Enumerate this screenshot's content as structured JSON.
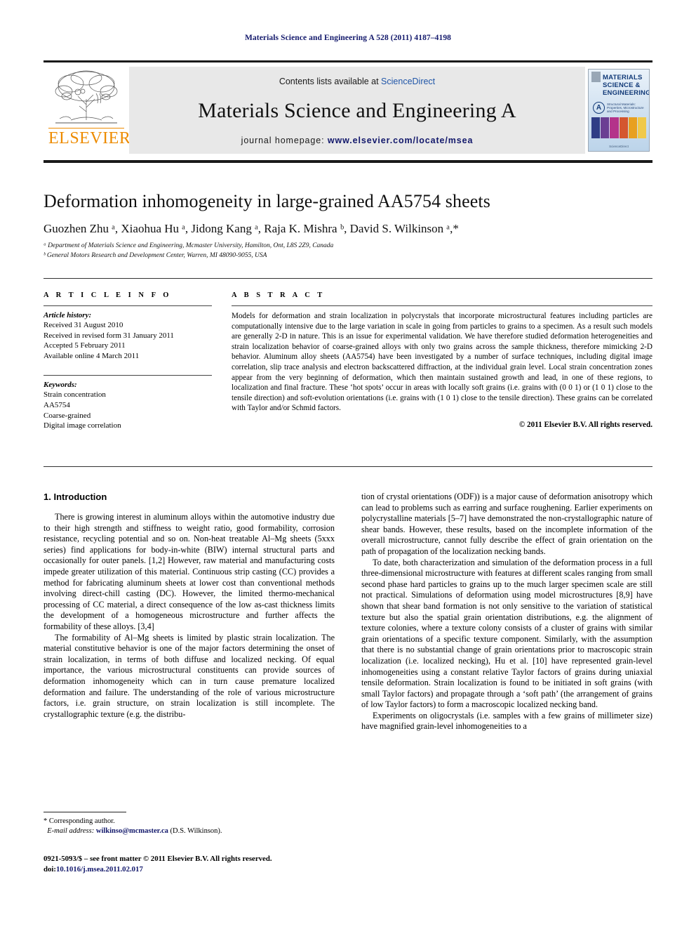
{
  "running_head": "Materials Science and Engineering A 528 (2011) 4187–4198",
  "masthead": {
    "publisher_name": "ELSEVIER",
    "contents_prefix": "Contents lists available at ",
    "contents_link": "ScienceDirect",
    "journal_title": "Materials Science and Engineering A",
    "homepage_prefix": "journal homepage:",
    "homepage_url": "www.elsevier.com/locate/msea",
    "cover": {
      "line1": "MATERIALS",
      "line2": "SCIENCE &",
      "line3": "ENGINEERING",
      "badge": "A",
      "badge_subtitle": "Structural Materials: Properties, Microstructure and Processing",
      "footer": "ScienceDirect",
      "tile_colors": [
        "#2f3d86",
        "#6b3f93",
        "#b4338a",
        "#d4562f",
        "#e8a020",
        "#f0c94a"
      ]
    }
  },
  "article": {
    "title": "Deformation inhomogeneity in large-grained AA5754 sheets",
    "authors": "Guozhen Zhu ᵃ, Xiaohua Hu ᵃ, Jidong Kang ᵃ, Raja K. Mishra ᵇ, David S. Wilkinson ᵃ,*",
    "affiliation_a": "ᵃ Department of Materials Science and Engineering, Mcmaster University, Hamilton, Ont, L8S 2Z9, Canada",
    "affiliation_b": "ᵇ General Motors Research and Development Center, Warren, MI 48090-9055, USA"
  },
  "article_info": {
    "heading": "A R T I C L E   I N F O",
    "history_label": "Article history:",
    "history": [
      "Received 31 August 2010",
      "Received in revised form 31 January 2011",
      "Accepted 5 February 2011",
      "Available online 4 March 2011"
    ],
    "keywords_label": "Keywords:",
    "keywords": [
      "Strain concentration",
      "AA5754",
      "Coarse-grained",
      "Digital image correlation"
    ]
  },
  "abstract": {
    "heading": "A B S T R A C T",
    "text": "Models for deformation and strain localization in polycrystals that incorporate microstructural features including particles are computationally intensive due to the large variation in scale in going from particles to grains to a specimen. As a result such models are generally 2-D in nature. This is an issue for experimental validation. We have therefore studied deformation heterogeneities and strain localization behavior of coarse-grained alloys with only two grains across the sample thickness, therefore mimicking 2-D behavior. Aluminum alloy sheets (AA5754) have been investigated by a number of surface techniques, including digital image correlation, slip trace analysis and electron backscattered diffraction, at the individual grain level. Local strain concentration zones appear from the very beginning of deformation, which then maintain sustained growth and lead, in one of these regions, to localization and final fracture. These ‘hot spots’ occur in areas with locally soft grains (i.e. grains with (0 0 1) or (1 0 1) close to the tensile direction) and soft-evolution orientations (i.e. grains with (1 0 1) close to the tensile direction). These grains can be correlated with Taylor and/or Schmid factors.",
    "copyright": "© 2011 Elsevier B.V. All rights reserved."
  },
  "body": {
    "section_number_title": "1.  Introduction",
    "left_paragraphs": [
      "There is growing interest in aluminum alloys within the automotive industry due to their high strength and stiffness to weight ratio, good formability, corrosion resistance, recycling potential and so on. Non-heat treatable Al–Mg sheets (5xxx series) find applications for body-in-white (BIW) internal structural parts and occasionally for outer panels. [1,2] However, raw material and manufacturing costs impede greater utilization of this material. Continuous strip casting (CC) provides a method for fabricating aluminum sheets at lower cost than conventional methods involving direct-chill casting (DC). However, the limited thermo-mechanical processing of CC material, a direct consequence of the low as-cast thickness limits the development of a homogeneous microstructure and further affects the formability of these alloys. [3,4]",
      "The formability of Al–Mg sheets is limited by plastic strain localization. The material constitutive behavior is one of the major factors determining the onset of strain localization, in terms of both diffuse and localized necking. Of equal importance, the various microstructural constituents can provide sources of deformation inhomogeneity which can in turn cause premature localized deformation and failure. The understanding of the role of various microstructure factors, i.e. grain structure, on strain localization is still incomplete. The crystallographic texture (e.g. the distribu-"
    ],
    "right_paragraphs": [
      "tion of crystal orientations (ODF)) is a major cause of deformation anisotropy which can lead to problems such as earring and surface roughening. Earlier experiments on polycrystalline materials [5–7] have demonstrated the non-crystallographic nature of shear bands. However, these results, based on the incomplete information of the overall microstructure, cannot fully describe the effect of grain orientation on the path of propagation of the localization necking bands.",
      "To date, both characterization and simulation of the deformation process in a full three-dimensional microstructure with features at different scales ranging from small second phase hard particles to grains up to the much larger specimen scale are still not practical. Simulations of deformation using model microstructures [8,9] have shown that shear band formation is not only sensitive to the variation of statistical texture but also the spatial grain orientation distributions, e.g. the alignment of texture colonies, where a texture colony consists of a cluster of grains with similar grain orientations of a specific texture component. Similarly, with the assumption that there is no substantial change of grain orientations prior to macroscopic strain localization (i.e. localized necking), Hu et al. [10] have represented grain-level inhomogeneities using a constant relative Taylor factors of grains during uniaxial tensile deformation. Strain localization is found to be initiated in soft grains (with small Taylor factors) and propagate through a ‘soft path’ (the arrangement of grains of low Taylor factors) to form a macroscopic localized necking band.",
      "Experiments on oligocrystals (i.e. samples with a few grains of millimeter size) have magnified grain-level inhomogeneities to a"
    ]
  },
  "footnote": {
    "corresponding": "* Corresponding author.",
    "email_label": "E-mail address:",
    "email": "wilkinso@mcmaster.ca",
    "email_owner": "(D.S. Wilkinson)."
  },
  "footer": {
    "issn_line": "0921-5093/$ – see front matter © 2011 Elsevier B.V. All rights reserved.",
    "doi_label": "doi:",
    "doi_value": "10.1016/j.msea.2011.02.017"
  },
  "colors": {
    "link": "#12186b",
    "sciencedirect": "#2056a8",
    "elsevier_orange": "#ED8B00",
    "band_bg": "#e8e8e8"
  }
}
